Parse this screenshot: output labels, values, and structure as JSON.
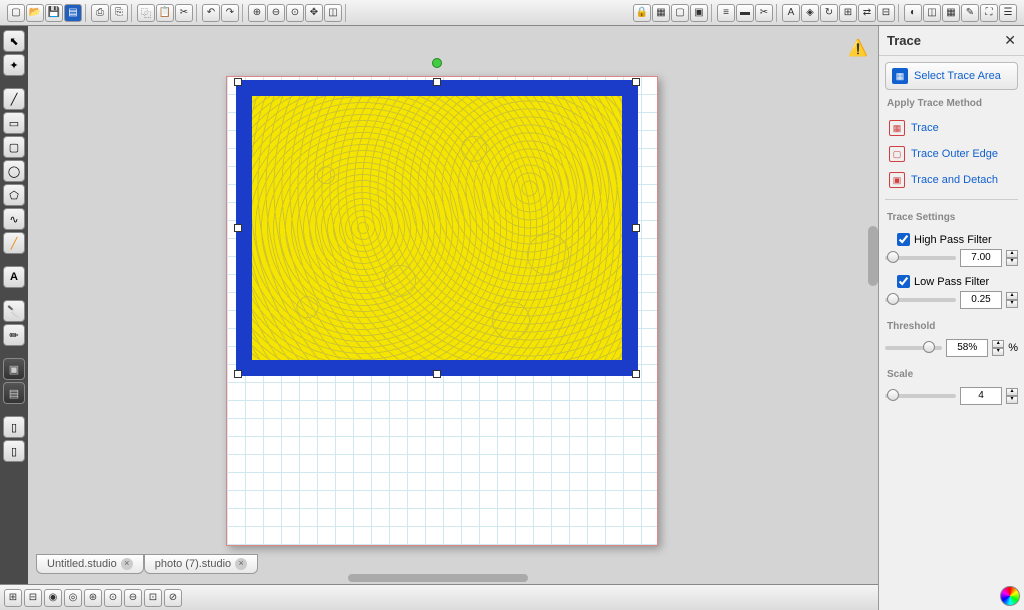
{
  "tabs": [
    {
      "label": "Untitled.studio"
    },
    {
      "label": "photo (7).studio"
    }
  ],
  "panel": {
    "title": "Trace",
    "select_area": "Select Trace Area",
    "method_label": "Apply Trace Method",
    "trace": "Trace",
    "outer": "Trace Outer Edge",
    "detach": "Trace and Detach",
    "settings_label": "Trace Settings",
    "hpf": "High Pass Filter",
    "hpf_val": "7.00",
    "lpf": "Low Pass Filter",
    "lpf_val": "0.25",
    "threshold_label": "Threshold",
    "threshold_val": "58%",
    "pct": "%",
    "scale_label": "Scale",
    "scale_val": "4"
  }
}
